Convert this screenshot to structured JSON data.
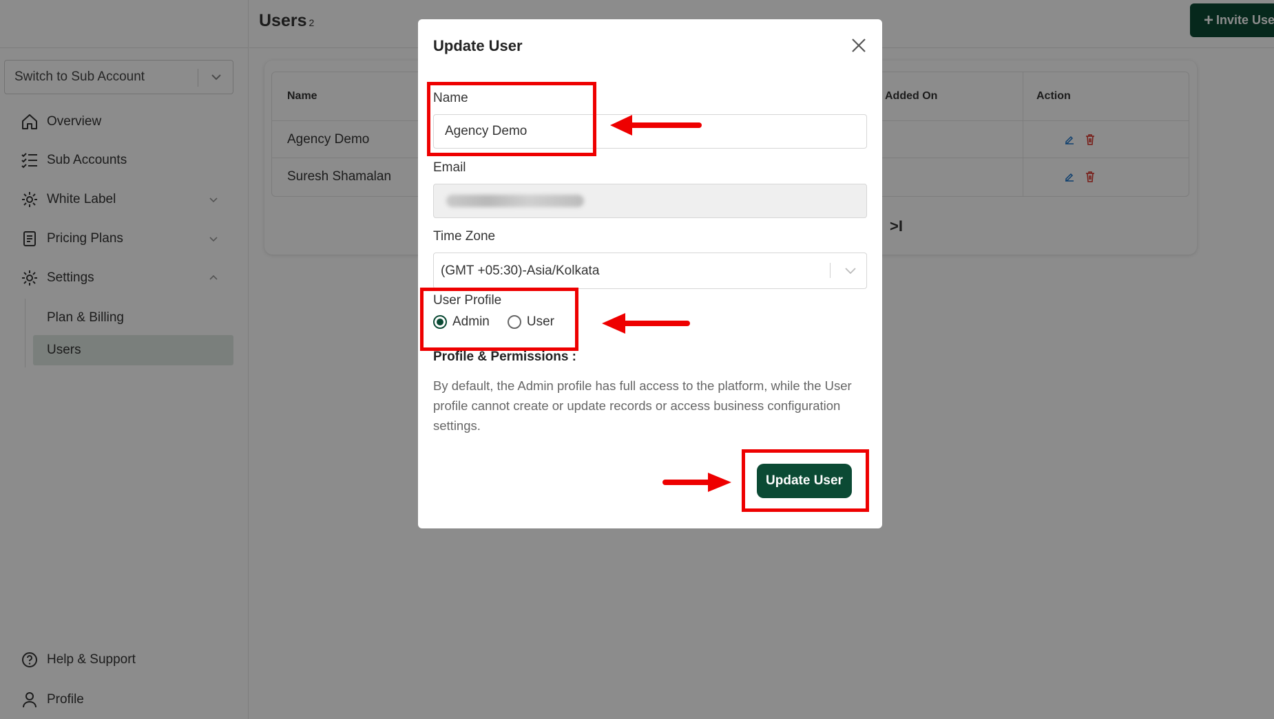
{
  "sidebar": {
    "account_switch": "Switch to Sub Account",
    "items": [
      {
        "label": "Overview",
        "icon": "home-icon"
      },
      {
        "label": "Sub Accounts",
        "icon": "checklist-icon"
      },
      {
        "label": "White Label",
        "icon": "gear-icon"
      },
      {
        "label": "Pricing Plans",
        "icon": "document-icon"
      },
      {
        "label": "Settings",
        "icon": "settings-icon"
      }
    ],
    "sub_items": [
      "Plan & Billing",
      "Users"
    ],
    "footer": [
      {
        "label": "Help & Support",
        "icon": "help-icon"
      },
      {
        "label": "Profile",
        "icon": "user-icon"
      }
    ]
  },
  "header": {
    "title": "Users",
    "count": "2",
    "invite_label": "Invite User"
  },
  "table": {
    "headers": [
      "Name",
      "Added On",
      "Action"
    ],
    "rows": [
      {
        "name": "Agency Demo"
      },
      {
        "name": "Suresh Shamalan"
      }
    ],
    "pager_last": ">I"
  },
  "modal": {
    "title": "Update User",
    "name_label": "Name",
    "name_value": "Agency Demo",
    "email_label": "Email",
    "timezone_label": "Time Zone",
    "timezone_value": "(GMT +05:30)-Asia/Kolkata",
    "profile_label": "User Profile",
    "profile_options": [
      "Admin",
      "User"
    ],
    "profile_selected": "Admin",
    "permissions_title": "Profile & Permissions :",
    "permissions_text": "By default, the Admin profile has full access to the platform, while the User profile cannot create or update records or access business configuration settings.",
    "submit_label": "Update User"
  },
  "colors": {
    "brand": "#0b4a34",
    "annotation": "#ee0000",
    "edit_icon": "#1a73c9",
    "delete_icon": "#d93025"
  }
}
